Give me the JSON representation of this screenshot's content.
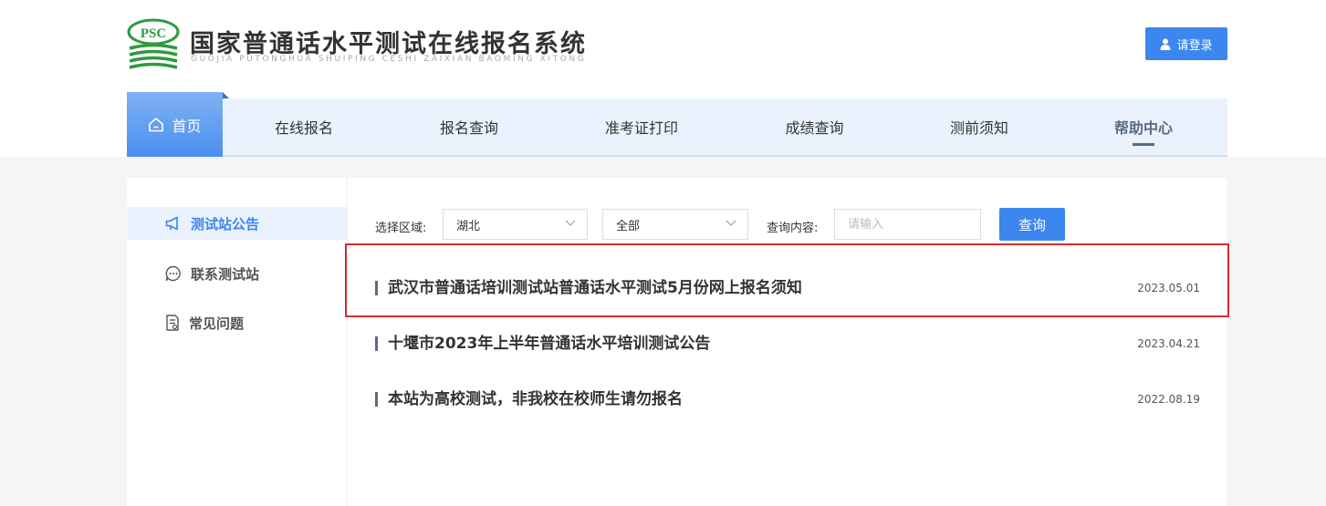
{
  "header": {
    "logo_text": "PSC",
    "title": "国家普通话水平测试在线报名系统",
    "subtitle": "GUOJIA PUTONGHUA SHUIPING CESHI ZAIXIAN BAOMING XITONG",
    "login_label": "请登录"
  },
  "nav": {
    "items": [
      {
        "label": "首页"
      },
      {
        "label": "在线报名"
      },
      {
        "label": "报名查询"
      },
      {
        "label": "准考证打印"
      },
      {
        "label": "成绩查询"
      },
      {
        "label": "测前须知"
      },
      {
        "label": "帮助中心"
      }
    ],
    "active_index": 6
  },
  "sidebar": {
    "items": [
      {
        "label": "测试站公告",
        "icon": "megaphone-icon"
      },
      {
        "label": "联系测试站",
        "icon": "chat-icon"
      },
      {
        "label": "常见问题",
        "icon": "document-icon"
      }
    ],
    "active_index": 0
  },
  "filters": {
    "region_label": "选择区域:",
    "region_value": "湖北",
    "category_value": "全部",
    "search_label": "查询内容:",
    "search_placeholder": "请输入",
    "search_value": "",
    "query_button": "查询"
  },
  "notices": [
    {
      "title": "武汉市普通话培训测试站普通话水平测试5月份网上报名须知",
      "date": "2023.05.01"
    },
    {
      "title": "十堰市2023年上半年普通话水平培训测试公告",
      "date": "2023.04.21"
    },
    {
      "title": "本站为高校测试，非我校在校师生请勿报名",
      "date": "2022.08.19"
    }
  ],
  "colors": {
    "primary": "#3c86f0",
    "nav_bg": "#eaf2fd",
    "logo_green": "#2e9a3e",
    "highlight_red": "#d92d2d"
  }
}
